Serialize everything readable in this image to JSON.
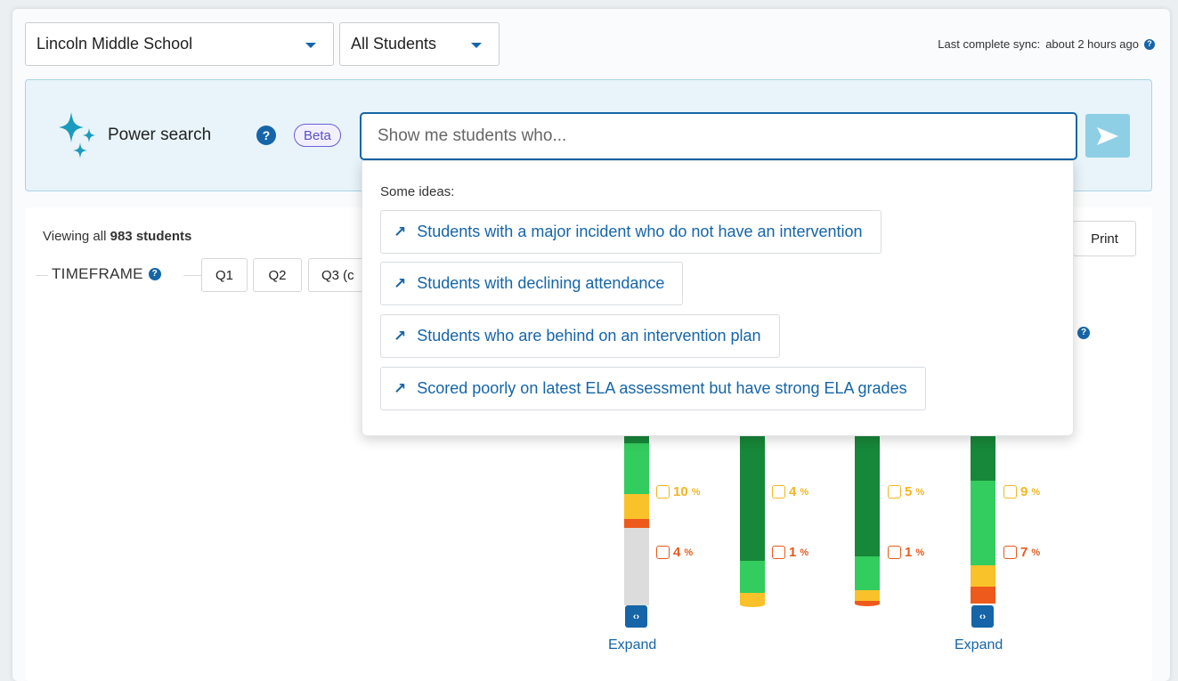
{
  "filters": {
    "school": "Lincoln Middle School",
    "students": "All Students"
  },
  "sync": {
    "label": "Last complete sync:",
    "value": "about 2 hours ago"
  },
  "power_search": {
    "label": "Power search",
    "help": "?",
    "badge": "Beta",
    "placeholder": "Show me students who...",
    "value": ""
  },
  "suggestions": {
    "title": "Some ideas:",
    "items": [
      "Students with a major incident who do not have an intervention",
      "Students with declining attendance",
      "Students who are behind on an intervention plan",
      "Scored poorly on latest ELA assessment but have strong ELA grades"
    ]
  },
  "summary": {
    "prefix": "Viewing all",
    "count": "983",
    "suffix": "students"
  },
  "print_label": "Print",
  "timeframe": {
    "label": "TIMEFRAME",
    "options": [
      "Q1",
      "Q2",
      "Q3 (c"
    ]
  },
  "chart_data": {
    "type": "bar",
    "stacked": true,
    "note": "Stacked distribution columns; upper portion hidden behind the suggestions dropdown",
    "columns": [
      {
        "yellow_pct": "10",
        "orange_pct": "4",
        "expand": "Expand"
      },
      {
        "yellow_pct": "4",
        "orange_pct": "1"
      },
      {
        "yellow_pct": "5",
        "orange_pct": "1"
      },
      {
        "yellow_pct": "9",
        "orange_pct": "7",
        "expand": "Expand"
      }
    ],
    "colors": {
      "dark_green": "#17873a",
      "green": "#33cc5e",
      "yellow": "#f9c22b",
      "orange": "#ee5a1b",
      "gray": "#dcdcdc",
      "yellow_text": "#f2b622",
      "orange_text": "#e55a1c"
    }
  },
  "colors": {
    "accent": "#1565a8",
    "power_bg": "#e8f4fa",
    "sparkle": "#1a9bbd",
    "send_button": "#8fcfe6",
    "beta": "#5a4fc4"
  }
}
